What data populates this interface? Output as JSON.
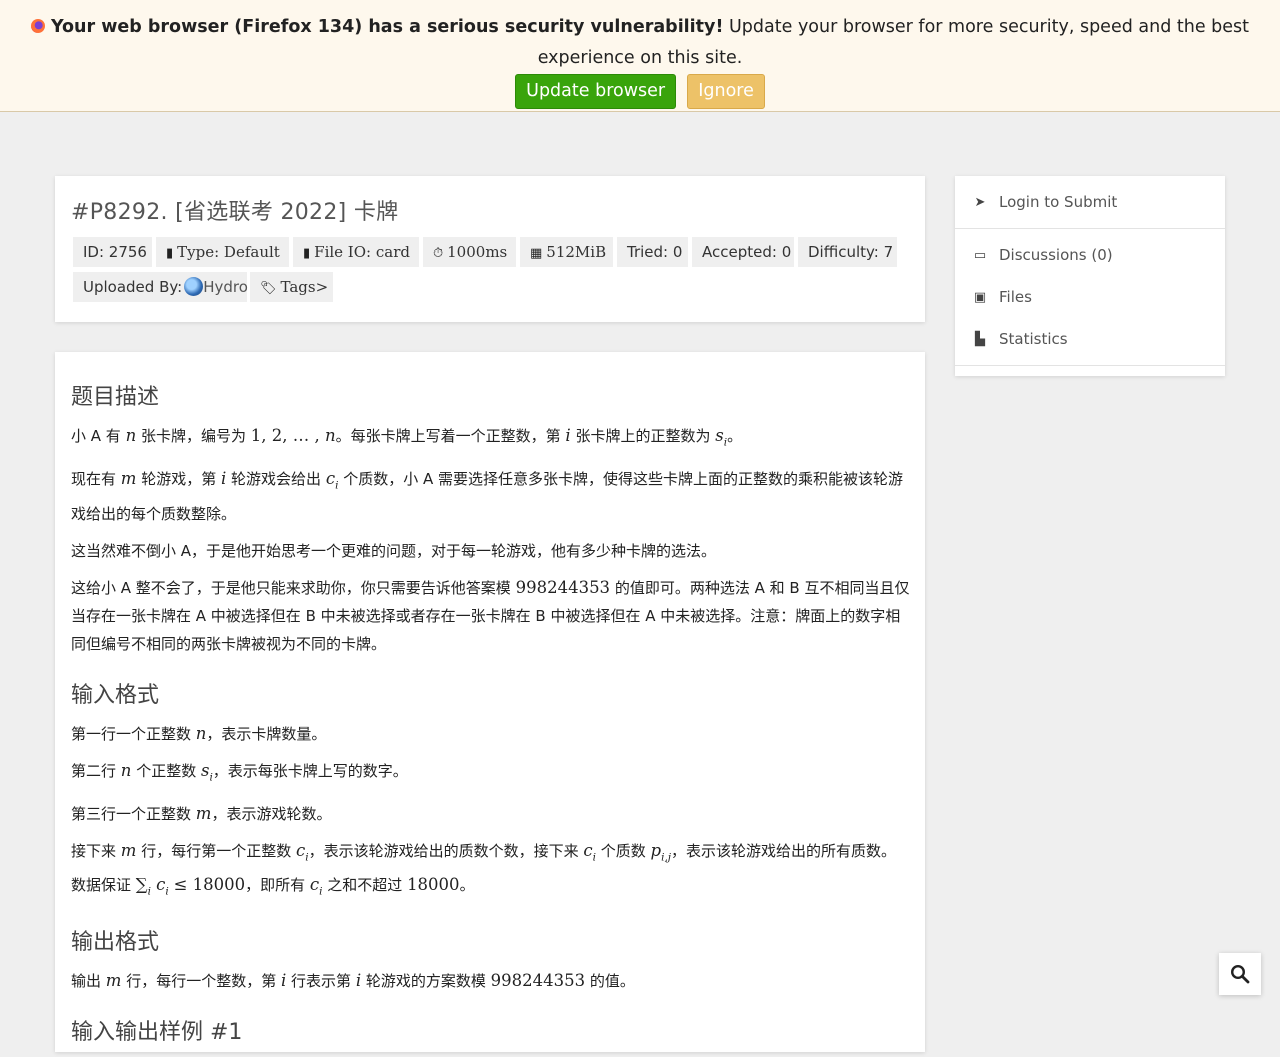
{
  "banner": {
    "bold_text": "Your web browser (Firefox 134) has a serious security vulnerability!",
    "text": " Update your browser for more security, speed and the best experience on this site.",
    "update_label": "Update browser",
    "ignore_label": "Ignore",
    "update_color": "#39a40b",
    "ignore_color": "#edc268"
  },
  "problem": {
    "title": "#P8292. [省选联考 2022] 卡牌",
    "chips": {
      "id": "ID: 2756",
      "type": "Type: Default",
      "fileio": "File IO: card",
      "time": "1000ms",
      "memory": "512MiB",
      "tried": "Tried: 0",
      "accepted": "Accepted: 0",
      "difficulty": "Difficulty: 7",
      "uploaded_label": "Uploaded By:",
      "uploader": "Hydro",
      "tags": "Tags>"
    }
  },
  "sidebar": {
    "login": "Login to Submit",
    "discussions": "Discussions (0)",
    "files": "Files",
    "statistics": "Statistics"
  },
  "content": {
    "h_desc": "题目描述",
    "h_input": "输入格式",
    "h_output": "输出格式",
    "h_sample": "输入输出样例 #1"
  }
}
